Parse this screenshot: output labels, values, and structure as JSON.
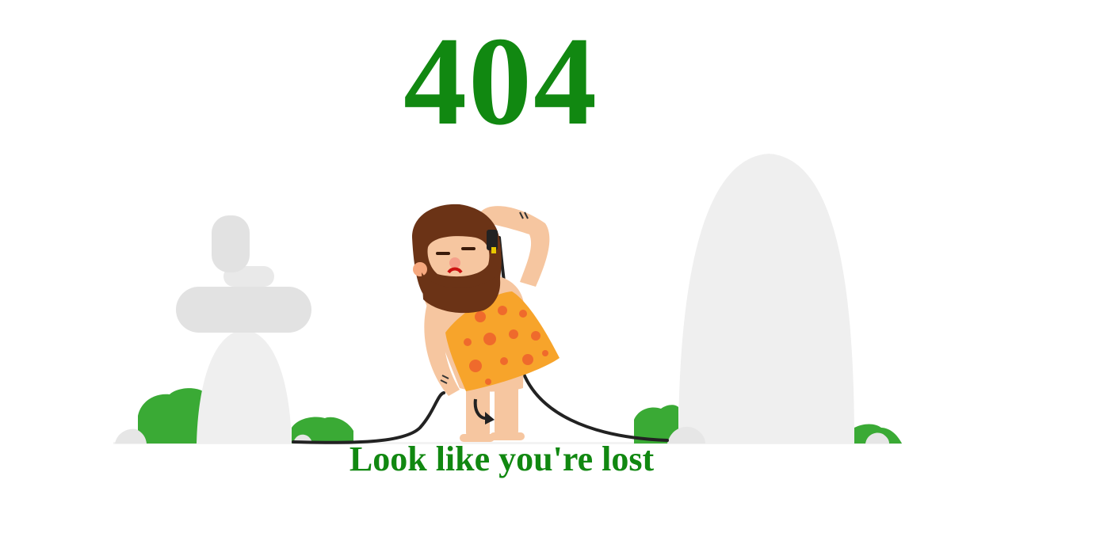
{
  "error": {
    "code": "404",
    "message": "Look like you're lost"
  },
  "illustration": {
    "subject": "caveman-with-cable-icon",
    "colors": {
      "text": "#118811",
      "rock": "#efefef",
      "bush": "#3aaa35",
      "skin": "#f6c6a0",
      "hair": "#6b3316",
      "fur": "#f7a42b",
      "fur_spots": "#ef6a2c",
      "cable": "#222222"
    }
  }
}
